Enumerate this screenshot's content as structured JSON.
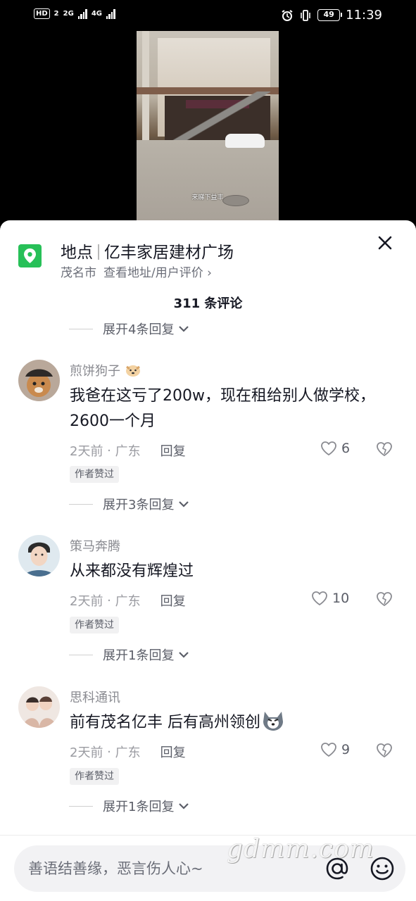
{
  "status": {
    "hd": "HD",
    "sim": "2",
    "net1": "2G",
    "net2": "4G",
    "battery": "49",
    "time": "11:39"
  },
  "video": {
    "caption": "来睇下益丰"
  },
  "location": {
    "label": "地点",
    "name": "亿丰家居建材广场",
    "city": "茂名市",
    "link": "查看地址/用户评价 ›",
    "accent": "#27c058"
  },
  "comments_count": "311 条评论",
  "expand_top": "展开4条回复",
  "comments": [
    {
      "name": "煎饼狗子",
      "text": "我爸在这亏了200w，现在租给别人做学校，2600一个月",
      "time": "2天前",
      "region": "广东",
      "reply": "回复",
      "likes": "6",
      "badge": "作者赞过",
      "expand": "展开3条回复"
    },
    {
      "name": "策马奔腾",
      "text": "从来都没有辉煌过",
      "time": "2天前",
      "region": "广东",
      "reply": "回复",
      "likes": "10",
      "badge": "作者赞过",
      "expand": "展开1条回复"
    },
    {
      "name": "思科通讯",
      "text": "前有茂名亿丰 后有高州领创",
      "time": "2天前",
      "region": "广东",
      "reply": "回复",
      "likes": "9",
      "badge": "作者赞过",
      "expand": "展开1条回复"
    }
  ],
  "input": {
    "placeholder": "善语结善缘，恶言伤人心~"
  },
  "watermark": "gdmm.com"
}
